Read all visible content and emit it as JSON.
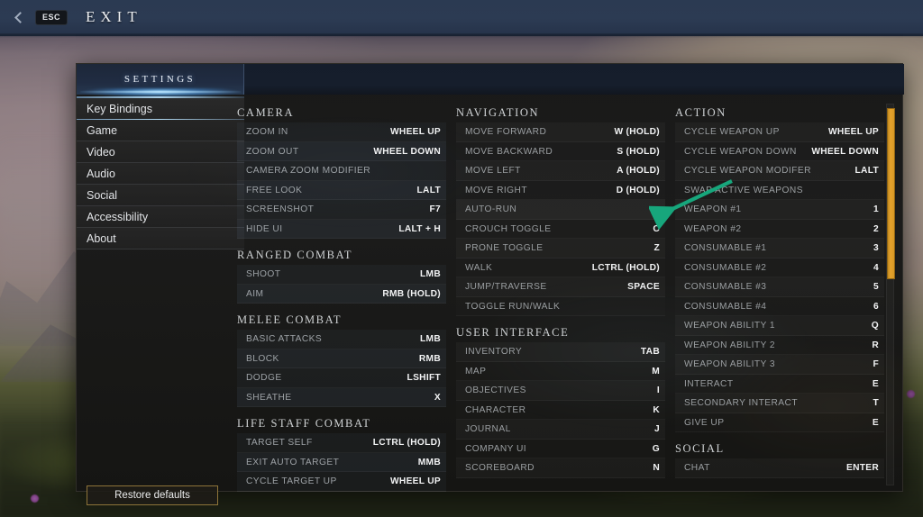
{
  "colors": {
    "accent_blue": "#8cd6ff",
    "scrollbar_orange": "#e5a32c",
    "restore_border": "#8e7439",
    "annotation_arrow": "#17a67c",
    "key_text": "#f1f2f3",
    "action_text": "#9da2a6"
  },
  "topbar": {
    "back_icon": "chevron-left-icon",
    "esc_key": "ESC",
    "exit_label": "EXIT"
  },
  "panel": {
    "header_title": "SETTINGS"
  },
  "sidebar": {
    "items": [
      {
        "label": "Key Bindings",
        "selected": true
      },
      {
        "label": "Game",
        "selected": false
      },
      {
        "label": "Video",
        "selected": false
      },
      {
        "label": "Audio",
        "selected": false
      },
      {
        "label": "Social",
        "selected": false
      },
      {
        "label": "Accessibility",
        "selected": false
      },
      {
        "label": "About",
        "selected": false
      }
    ],
    "restore_defaults_label": "Restore defaults"
  },
  "columns": [
    {
      "id": "column-1",
      "sections": [
        {
          "title": "CAMERA",
          "rows": [
            {
              "action": "ZOOM IN",
              "key": "WHEEL UP"
            },
            {
              "action": "ZOOM OUT",
              "key": "WHEEL DOWN"
            },
            {
              "action": "CAMERA ZOOM MODIFIER",
              "key": ""
            },
            {
              "action": "FREE LOOK",
              "key": "LALT"
            },
            {
              "action": "SCREENSHOT",
              "key": "F7"
            },
            {
              "action": "HIDE UI",
              "key": "LALT + H"
            }
          ]
        },
        {
          "title": "RANGED COMBAT",
          "rows": [
            {
              "action": "SHOOT",
              "key": "LMB"
            },
            {
              "action": "AIM",
              "key": "RMB (HOLD)"
            }
          ]
        },
        {
          "title": "MELEE COMBAT",
          "rows": [
            {
              "action": "BASIC ATTACKS",
              "key": "LMB"
            },
            {
              "action": "BLOCK",
              "key": "RMB"
            },
            {
              "action": "DODGE",
              "key": "LSHIFT"
            },
            {
              "action": "SHEATHE",
              "key": "X"
            }
          ]
        },
        {
          "title": "LIFE STAFF COMBAT",
          "rows": [
            {
              "action": "TARGET SELF",
              "key": "LCTRL (HOLD)"
            },
            {
              "action": "EXIT AUTO TARGET",
              "key": "MMB"
            },
            {
              "action": "CYCLE TARGET UP",
              "key": "WHEEL UP"
            }
          ]
        }
      ]
    },
    {
      "id": "column-2",
      "sections": [
        {
          "title": "NAVIGATION",
          "rows": [
            {
              "action": "MOVE FORWARD",
              "key": "W (HOLD)"
            },
            {
              "action": "MOVE BACKWARD",
              "key": "S (HOLD)"
            },
            {
              "action": "MOVE LEFT",
              "key": "A (HOLD)"
            },
            {
              "action": "MOVE RIGHT",
              "key": "D (HOLD)"
            },
            {
              "action": "AUTO-RUN",
              "key": "=",
              "highlighted": true
            },
            {
              "action": "CROUCH TOGGLE",
              "key": "C"
            },
            {
              "action": "PRONE TOGGLE",
              "key": "Z"
            },
            {
              "action": "WALK",
              "key": "LCTRL (HOLD)"
            },
            {
              "action": "JUMP/TRAVERSE",
              "key": "SPACE"
            },
            {
              "action": "TOGGLE RUN/WALK",
              "key": ""
            }
          ]
        },
        {
          "title": "USER INTERFACE",
          "rows": [
            {
              "action": "INVENTORY",
              "key": "TAB"
            },
            {
              "action": "MAP",
              "key": "M"
            },
            {
              "action": "OBJECTIVES",
              "key": "I"
            },
            {
              "action": "CHARACTER",
              "key": "K"
            },
            {
              "action": "JOURNAL",
              "key": "J"
            },
            {
              "action": "COMPANY UI",
              "key": "G"
            },
            {
              "action": "SCOREBOARD",
              "key": "N"
            }
          ]
        }
      ]
    },
    {
      "id": "column-3",
      "sections": [
        {
          "title": "ACTION",
          "rows": [
            {
              "action": "CYCLE WEAPON UP",
              "key": "WHEEL UP"
            },
            {
              "action": "CYCLE WEAPON DOWN",
              "key": "WHEEL DOWN"
            },
            {
              "action": "CYCLE WEAPON MODIFER",
              "key": "LALT"
            },
            {
              "action": "SWAP ACTIVE WEAPONS",
              "key": ""
            },
            {
              "action": "WEAPON #1",
              "key": "1"
            },
            {
              "action": "WEAPON #2",
              "key": "2"
            },
            {
              "action": "CONSUMABLE #1",
              "key": "3"
            },
            {
              "action": "CONSUMABLE #2",
              "key": "4"
            },
            {
              "action": "CONSUMABLE #3",
              "key": "5"
            },
            {
              "action": "CONSUMABLE #4",
              "key": "6"
            },
            {
              "action": "WEAPON ABILITY 1",
              "key": "Q"
            },
            {
              "action": "WEAPON ABILITY 2",
              "key": "R"
            },
            {
              "action": "WEAPON ABILITY 3",
              "key": "F"
            },
            {
              "action": "INTERACT",
              "key": "E"
            },
            {
              "action": "SECONDARY INTERACT",
              "key": "T"
            },
            {
              "action": "GIVE UP",
              "key": "E"
            }
          ]
        },
        {
          "title": "SOCIAL",
          "rows": [
            {
              "action": "CHAT",
              "key": "ENTER"
            }
          ]
        }
      ]
    }
  ],
  "scrollbar": {
    "orientation": "vertical",
    "thumb_position_percent": 1,
    "thumb_size_percent": 45
  },
  "annotation": {
    "type": "arrow",
    "points_to": "auto-run-key-value"
  }
}
